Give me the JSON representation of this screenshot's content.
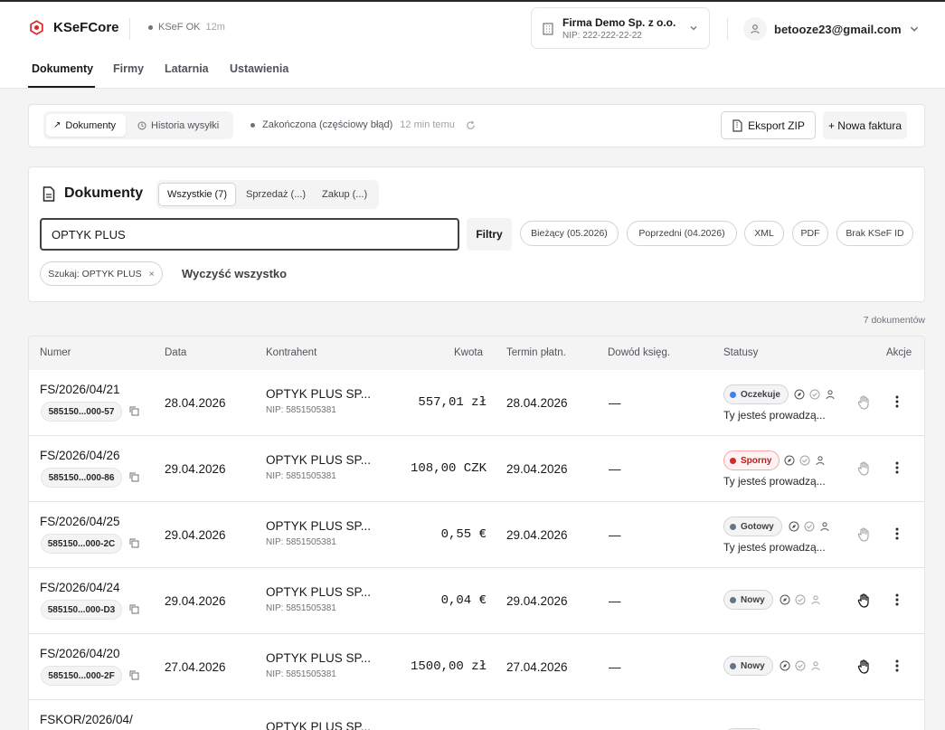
{
  "app": {
    "name": "KSeFCore",
    "ksef_status": "KSeF OK",
    "ksef_age": "12m",
    "icon": "hexagon-logo-icon",
    "accent": "#dc2626"
  },
  "company": {
    "name": "Firma Demo Sp. z o.o.",
    "nip": "NIP: 222-222-22-22"
  },
  "user": {
    "email": "betooze23@gmail.com"
  },
  "nav": {
    "items": [
      "Dokumenty",
      "Firmy",
      "Latarnia",
      "Ustawienia"
    ],
    "active": "Dokumenty"
  },
  "toolbar": {
    "seg_documents": "Dokumenty",
    "seg_history": "Historia wysyłki",
    "sync_status": "Zakończona (częściowy błąd)",
    "sync_time": "12 min temu",
    "export_label": "Eksport ZIP",
    "new_invoice_label": "+ Nowa faktura"
  },
  "documents": {
    "title": "Dokumenty",
    "tabs": [
      "Wszystkie (7)",
      "Sprzedaż (...)",
      "Zakup (...)"
    ],
    "active_tab": "Wszystkie (7)",
    "search_value": "OPTYK PLUS",
    "filters_label": "Filtry",
    "quick_filters": [
      "Bieżący (05.2026)",
      "Poprzedni (04.2026)",
      "XML",
      "PDF",
      "Brak KSeF ID"
    ],
    "active_chip": "Szukaj: OPTYK PLUS",
    "chip_close": "×",
    "clear_all": "Wyczyść wszystko",
    "count": "7 dokumentów"
  },
  "table": {
    "headers": [
      "Numer",
      "Data",
      "Kontrahent",
      "Kwota",
      "Termin płatn.",
      "Dowód księg.",
      "Statusy",
      "Akcje"
    ],
    "rows": [
      {
        "number": "FS/2026/04/21",
        "ksef_id": "585150...000-57",
        "date": "28.04.2026",
        "contractor": "OPTYK PLUS SP...",
        "nip": "NIP: 5851505381",
        "amount": "557,01 zł",
        "due": "28.04.2026",
        "proof": "—",
        "status": "Oczekuje",
        "status_color": "#3b82f6",
        "status_style": "grey",
        "person": "Ty jesteś prowadzą...",
        "hand_active": false
      },
      {
        "number": "FS/2026/04/26",
        "ksef_id": "585150...000-86",
        "date": "29.04.2026",
        "contractor": "OPTYK PLUS SP...",
        "nip": "NIP: 5851505381",
        "amount": "108,00 CZK",
        "due": "29.04.2026",
        "proof": "—",
        "status": "Sporny",
        "status_color": "#dc2626",
        "status_style": "red",
        "person": "Ty jesteś prowadzą...",
        "hand_active": false
      },
      {
        "number": "FS/2026/04/25",
        "ksef_id": "585150...000-2C",
        "date": "29.04.2026",
        "contractor": "OPTYK PLUS SP...",
        "nip": "NIP: 5851505381",
        "amount": "0,55 €",
        "due": "29.04.2026",
        "proof": "—",
        "status": "Gotowy",
        "status_color": "#64748b",
        "status_style": "grey",
        "person": "Ty jesteś prowadzą...",
        "hand_active": false
      },
      {
        "number": "FS/2026/04/24",
        "ksef_id": "585150...000-D3",
        "date": "29.04.2026",
        "contractor": "OPTYK PLUS SP...",
        "nip": "NIP: 5851505381",
        "amount": "0,04 €",
        "due": "29.04.2026",
        "proof": "—",
        "status": "Nowy",
        "status_color": "#64748b",
        "status_style": "grey",
        "person": "",
        "hand_active": true
      },
      {
        "number": "FS/2026/04/20",
        "ksef_id": "585150...000-2F",
        "date": "27.04.2026",
        "contractor": "OPTYK PLUS SP...",
        "nip": "NIP: 5851505381",
        "amount": "1500,00 zł",
        "due": "27.04.2026",
        "proof": "—",
        "status": "Nowy",
        "status_color": "#64748b",
        "status_style": "grey",
        "person": "",
        "hand_active": true
      },
      {
        "number": "FSKOR/2026/04/",
        "ksef_id": "",
        "date": "",
        "contractor": "OPTYK PLUS SP...",
        "nip": "",
        "amount": "",
        "due": "",
        "proof": "",
        "status": "",
        "status_color": "#64748b",
        "status_style": "grey",
        "person": "",
        "hand_active": false
      }
    ]
  }
}
